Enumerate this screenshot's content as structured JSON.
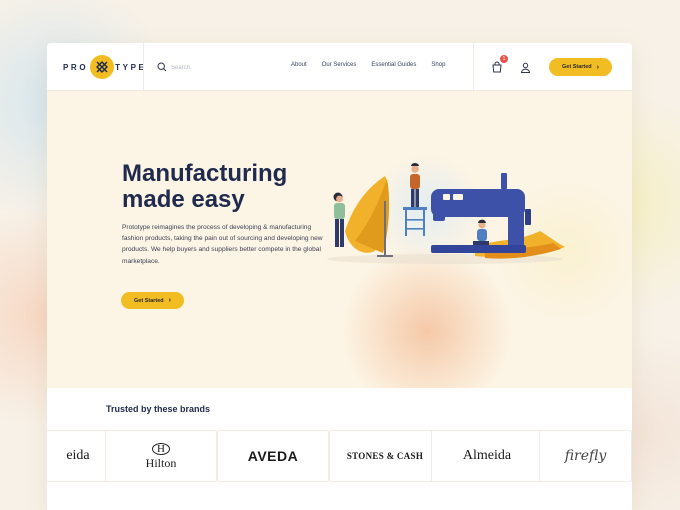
{
  "brand": {
    "logo_text_left": "PRO",
    "logo_text_right": "TYPE"
  },
  "search": {
    "placeholder": "Search"
  },
  "nav": {
    "items": [
      "About",
      "Our Services",
      "Essential Guides",
      "Shop"
    ]
  },
  "cart": {
    "badge": "1"
  },
  "header": {
    "cta_label": "Get Started"
  },
  "hero": {
    "title_line1": "Manufacturing",
    "title_line2": "made easy",
    "description": "Prototype reimagines the process of developing & manufacturing fashion products, taking the pain out of sourcing and developing new products. We help buyers and suppliers better compete in the global marketplace.",
    "cta_label": "Get Started"
  },
  "brands": {
    "title": "Trusted by these brands",
    "items": [
      "eida",
      "Hilton",
      "AVEDA",
      "STONES & CASH",
      "Almeida",
      "firefly"
    ]
  },
  "colors": {
    "accent": "#f2bd22",
    "navy": "#1f2a4c",
    "machine": "#3d51a8",
    "fabric": "#f2b12a"
  }
}
